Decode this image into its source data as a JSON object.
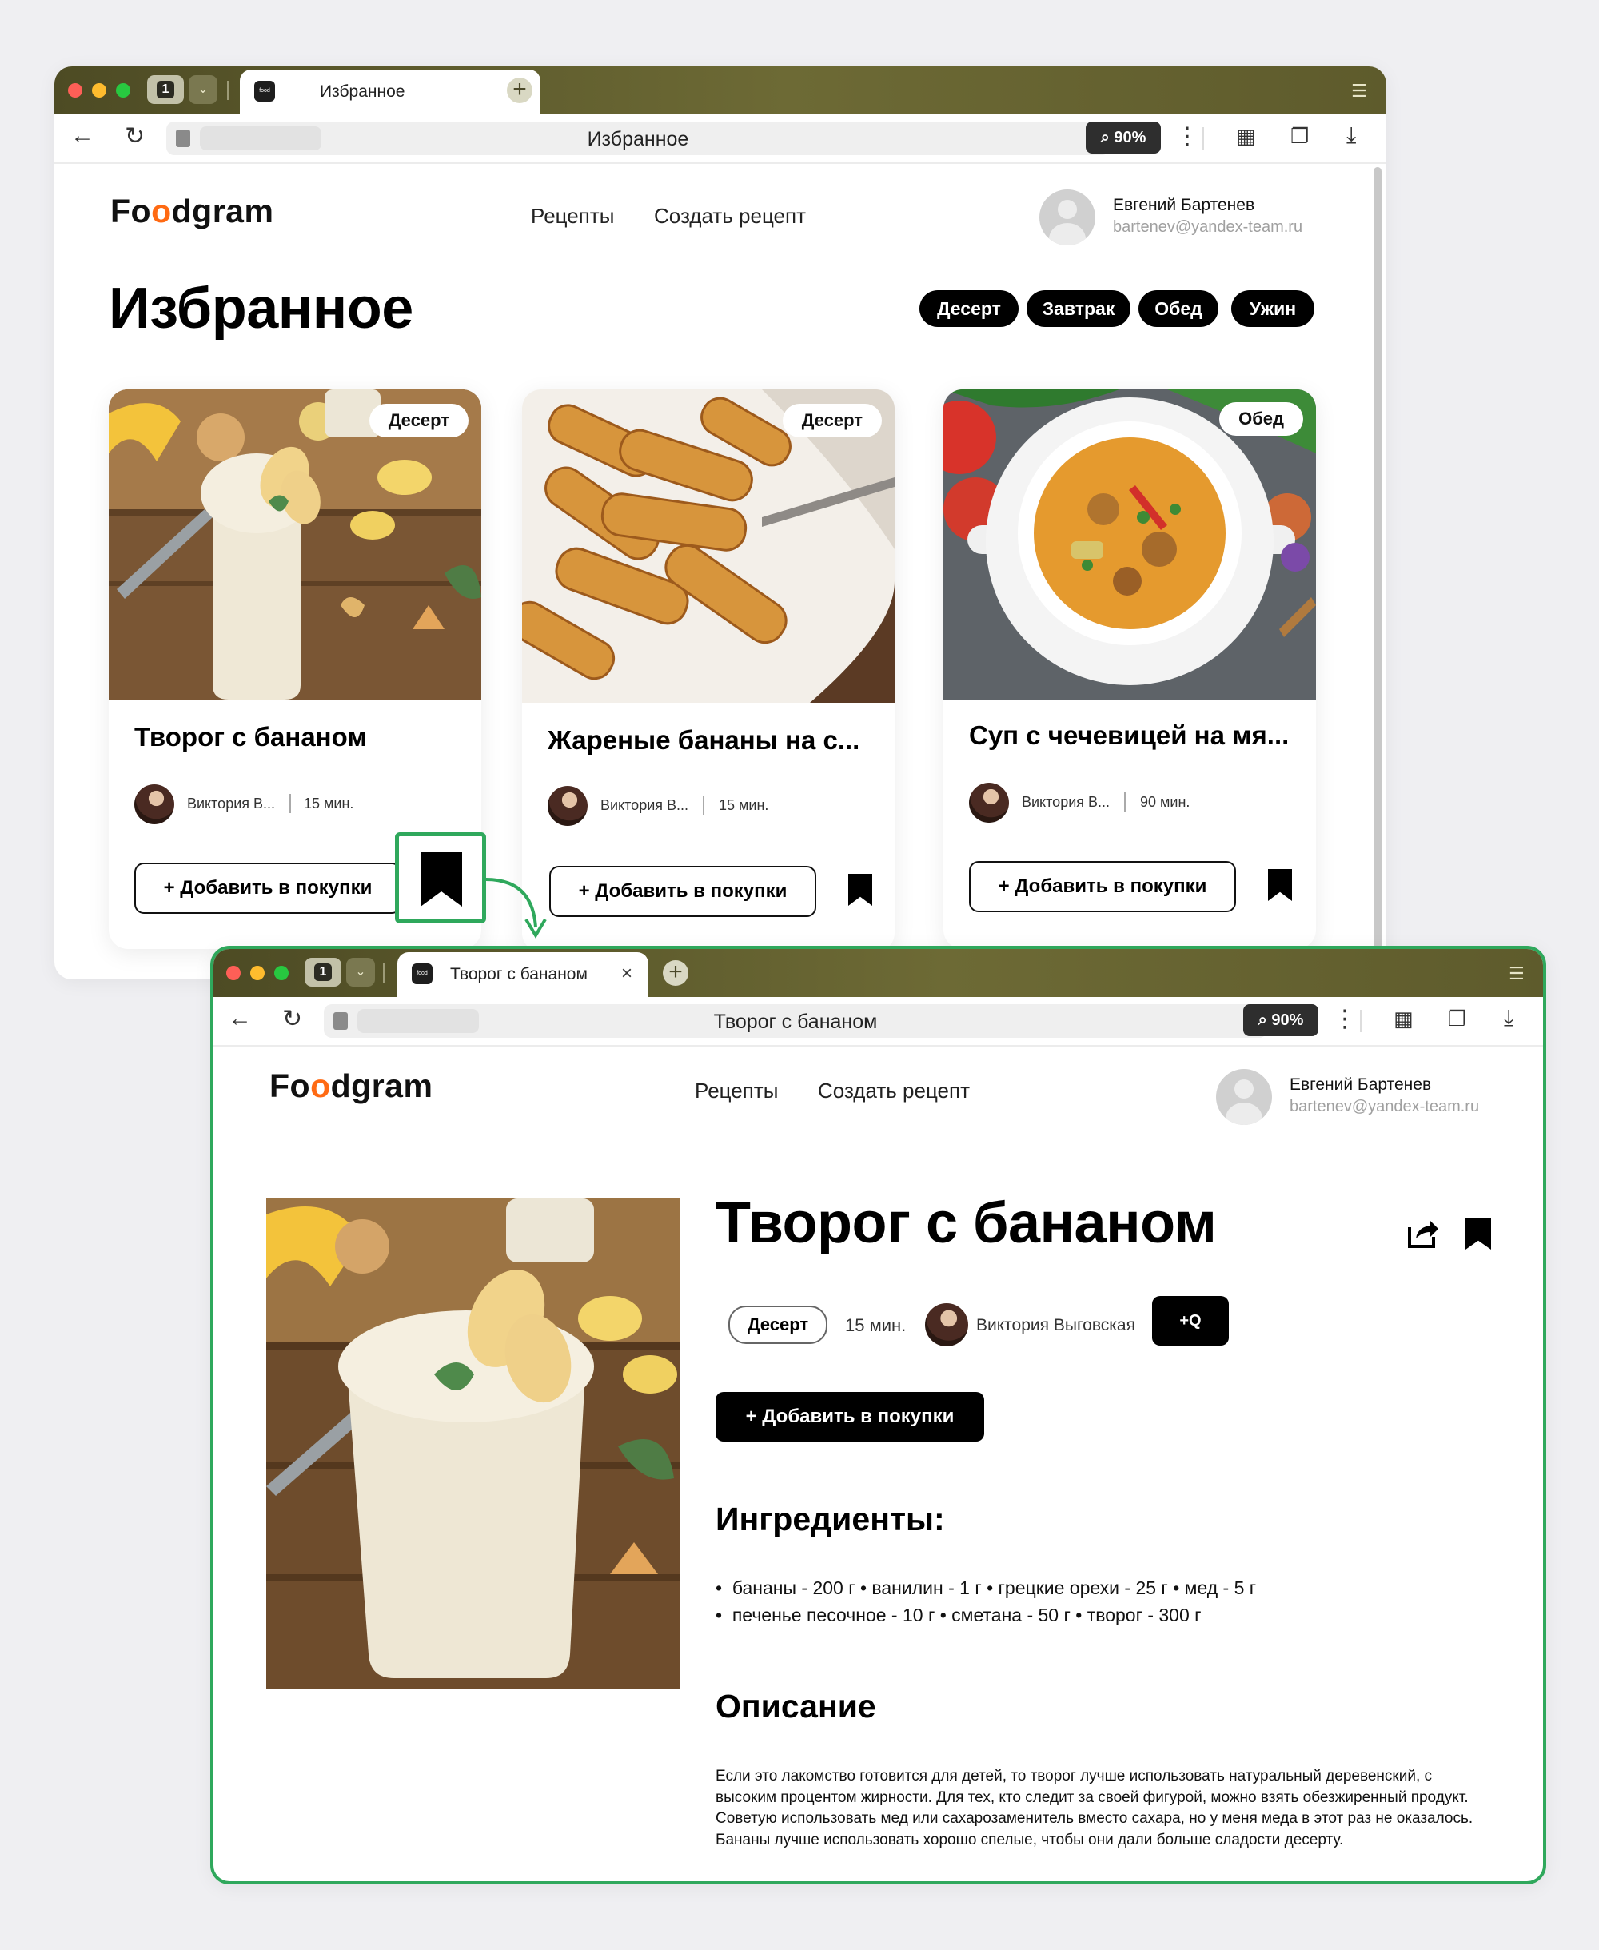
{
  "browser_top": {
    "tab_count": "1",
    "tab_title": "Избранное",
    "address": "Избранное",
    "zoom": "90%"
  },
  "browser_bottom": {
    "tab_count": "1",
    "tab_title": "Творог с бананом",
    "address": "Творог с бананом",
    "zoom": "90%"
  },
  "site": {
    "logo_pre": "Fo",
    "logo_o": "o",
    "logo_post": "dgram",
    "favicon_text": "food gram",
    "nav": {
      "recipes": "Рецепты",
      "create": "Создать рецепт"
    },
    "user": {
      "name": "Евгений Бартенев",
      "email": "bartenev@yandex-team.ru"
    }
  },
  "favorites": {
    "title": "Избранное",
    "filters": [
      "Десерт",
      "Завтрак",
      "Обед",
      "Ужин"
    ],
    "cards": [
      {
        "category": "Десерт",
        "title": "Творог с бананом",
        "author": "Виктория В...",
        "time": "15 мин.",
        "add_label": "+ Добавить в покупки"
      },
      {
        "category": "Десерт",
        "title": "Жареные бананы на с...",
        "author": "Виктория В...",
        "time": "15 мин.",
        "add_label": "+ Добавить в покупки"
      },
      {
        "category": "Обед",
        "title": "Суп с чечевицей на мя...",
        "author": "Виктория В...",
        "time": "90 мин.",
        "add_label": "+ Добавить в покупки"
      }
    ]
  },
  "recipe": {
    "title": "Творог с бананом",
    "category": "Десерт",
    "time": "15 мин.",
    "author": "Виктория Выговская",
    "subscribe_icon": "+Q",
    "add_label": "+ Добавить в покупки",
    "ingredients_title": "Ингредиенты:",
    "ingredients_line1": "бананы - 200 г  •  ванилин - 1 г  •  грецкие орехи - 25 г  •  мед - 5 г",
    "ingredients_line2": "печенье песочное - 10 г  •  сметана - 50 г  •  творог - 300 г",
    "description_title": "Описание",
    "description": "Если это лакомство готовится для детей, то творог лучше использовать натуральный деревенский, с высоким процентом жирности. Для тех, кто следит за своей фигурой, можно взять обезжиренный продукт. Советую использовать мед или сахарозаменитель вместо сахара, но у меня меда в этот раз не оказалось. Бананы лучше использовать хорошо спелые, чтобы они дали больше сладости десерту."
  },
  "colors": {
    "highlight": "#2fa85c",
    "brand_orange": "#ff6a13",
    "tabbar": "#5e5b2c"
  }
}
